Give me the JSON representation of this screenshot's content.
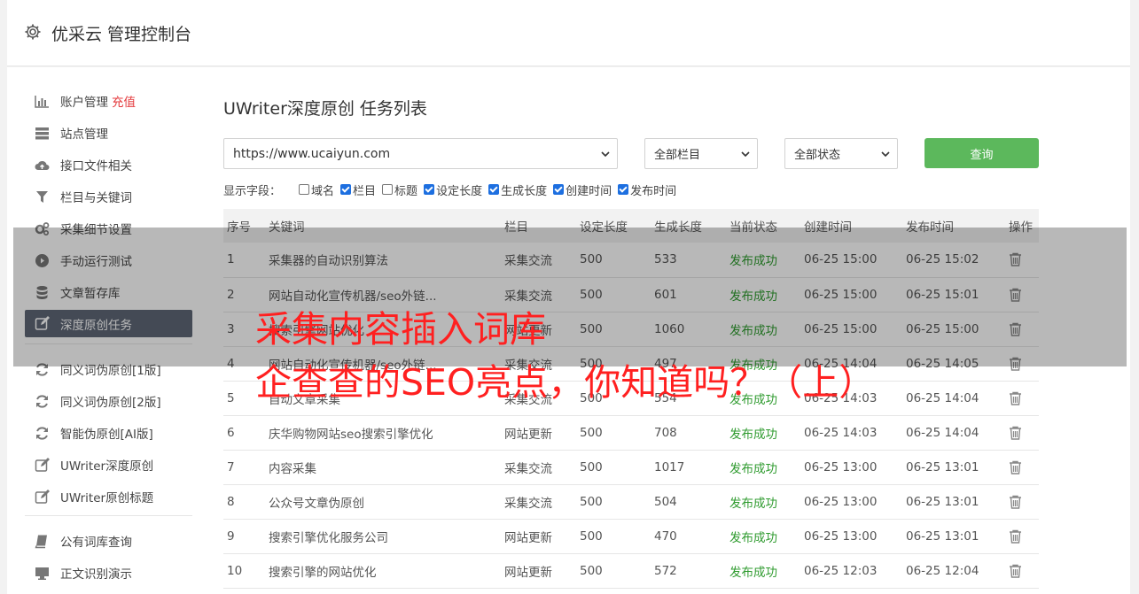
{
  "app": {
    "title": "优采云 管理控制台"
  },
  "sidebar": {
    "groups": [
      [
        {
          "label": "账户管理",
          "extra": "充值",
          "icon": "bar-chart-icon"
        },
        {
          "label": "站点管理",
          "icon": "server-icon"
        },
        {
          "label": "接口文件相关",
          "icon": "cloud-upload-icon"
        },
        {
          "label": "栏目与关键词",
          "icon": "filter-icon"
        },
        {
          "label": "采集细节设置",
          "icon": "cogs-icon"
        },
        {
          "label": "手动运行测试",
          "icon": "play-circle-icon"
        },
        {
          "label": "文章暂存库",
          "icon": "database-icon"
        },
        {
          "label": "深度原创任务",
          "icon": "edit-icon",
          "active": true
        }
      ],
      [
        {
          "label": "同义词伪原创[1版]",
          "icon": "refresh-icon"
        },
        {
          "label": "同义词伪原创[2版]",
          "icon": "refresh-icon"
        },
        {
          "label": "智能伪原创[AI版]",
          "icon": "refresh-icon"
        },
        {
          "label": "UWriter深度原创",
          "icon": "edit-icon"
        },
        {
          "label": "UWriter原创标题",
          "icon": "edit-icon"
        }
      ],
      [
        {
          "label": "公有词库查询",
          "icon": "book-icon"
        },
        {
          "label": "正文识别演示",
          "icon": "desktop-icon"
        }
      ]
    ]
  },
  "main": {
    "title": "UWriter深度原创 任务列表",
    "url_select": "https://www.ucaiyun.com",
    "column_select": "全部栏目",
    "status_select": "全部状态",
    "query_button": "查询",
    "fields_label": "显示字段：",
    "fields": [
      {
        "label": "域名",
        "checked": false
      },
      {
        "label": "栏目",
        "checked": true
      },
      {
        "label": "标题",
        "checked": false
      },
      {
        "label": "设定长度",
        "checked": true
      },
      {
        "label": "生成长度",
        "checked": true
      },
      {
        "label": "创建时间",
        "checked": true
      },
      {
        "label": "发布时间",
        "checked": true
      }
    ],
    "table": {
      "headers": [
        "序号",
        "关键词",
        "栏目",
        "设定长度",
        "生成长度",
        "当前状态",
        "创建时间",
        "发布时间",
        "操作"
      ],
      "rows": [
        [
          "1",
          "采集器的自动识别算法",
          "采集交流",
          "500",
          "533",
          "发布成功",
          "06-25 15:00",
          "06-25 15:02"
        ],
        [
          "2",
          "网站自动化宣传机器/seo外链...",
          "采集交流",
          "500",
          "601",
          "发布成功",
          "06-25 15:00",
          "06-25 15:01"
        ],
        [
          "3",
          "搜索引擎网站优化",
          "网站更新",
          "500",
          "1060",
          "发布成功",
          "06-25 15:00",
          "06-25 15:00"
        ],
        [
          "4",
          "网站自动化宣传机器/seo外链...",
          "采集交流",
          "500",
          "497",
          "发布成功",
          "06-25 14:04",
          "06-25 14:05"
        ],
        [
          "5",
          "自动文章采集",
          "采集交流",
          "500",
          "554",
          "发布成功",
          "06-25 14:03",
          "06-25 14:04"
        ],
        [
          "6",
          "庆华购物网站seo搜索引擎优化",
          "网站更新",
          "500",
          "708",
          "发布成功",
          "06-25 14:03",
          "06-25 14:04"
        ],
        [
          "7",
          "内容采集",
          "采集交流",
          "500",
          "1017",
          "发布成功",
          "06-25 13:00",
          "06-25 13:01"
        ],
        [
          "8",
          "公众号文章伪原创",
          "采集交流",
          "500",
          "504",
          "发布成功",
          "06-25 13:00",
          "06-25 13:01"
        ],
        [
          "9",
          "搜索引擎优化服务公司",
          "网站更新",
          "500",
          "470",
          "发布成功",
          "06-25 13:00",
          "06-25 13:01"
        ],
        [
          "10",
          "搜索引擎的网站优化",
          "网站更新",
          "500",
          "572",
          "发布成功",
          "06-25 12:03",
          "06-25 12:04"
        ]
      ]
    }
  },
  "overlay": {
    "line1": "采集内容插入词库",
    "line2": "企查查的SEO亮点，你知道吗？（上）"
  }
}
